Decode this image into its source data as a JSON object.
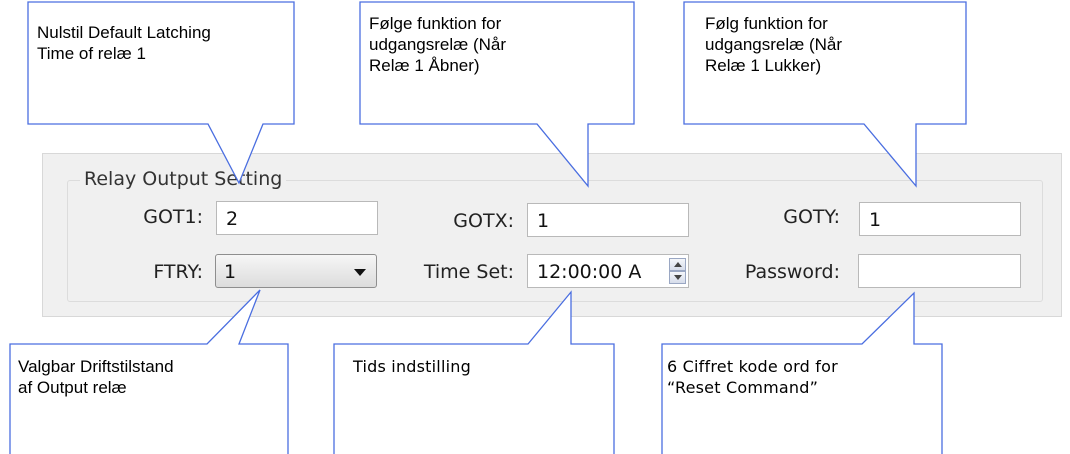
{
  "group": {
    "title": "Relay Output Setting"
  },
  "fields": {
    "got1": {
      "label": "GOT1:",
      "value": "2"
    },
    "gotx": {
      "label": "GOTX:",
      "value": "1"
    },
    "goty": {
      "label": "GOTY:",
      "value": "1"
    },
    "ftry": {
      "label": "FTRY:",
      "value": "1"
    },
    "time_set": {
      "label": "Time Set:",
      "value": "12:00:00 A"
    },
    "password": {
      "label": "Password:",
      "value": ""
    }
  },
  "callouts": {
    "top_left": [
      "Nulstil Default Latching",
      "Time of relæ 1"
    ],
    "top_mid": [
      "Følge funktion for",
      "udgangsrelæ (Når",
      "Relæ 1 Åbner)"
    ],
    "top_right": [
      "Følg funktion for",
      "udgangsrelæ (Når",
      "Relæ 1 Lukker)"
    ],
    "bottom_left": [
      "Valgbar Driftstilstand",
      "af Output relæ"
    ],
    "bottom_mid": [
      "Tids indstilling"
    ],
    "bottom_right": [
      "6 Ciffret kode ord for",
      "“Reset Command”"
    ]
  },
  "colors": {
    "callout_border": "#4a6ee0",
    "panel_bg": "#f0f0f0"
  }
}
